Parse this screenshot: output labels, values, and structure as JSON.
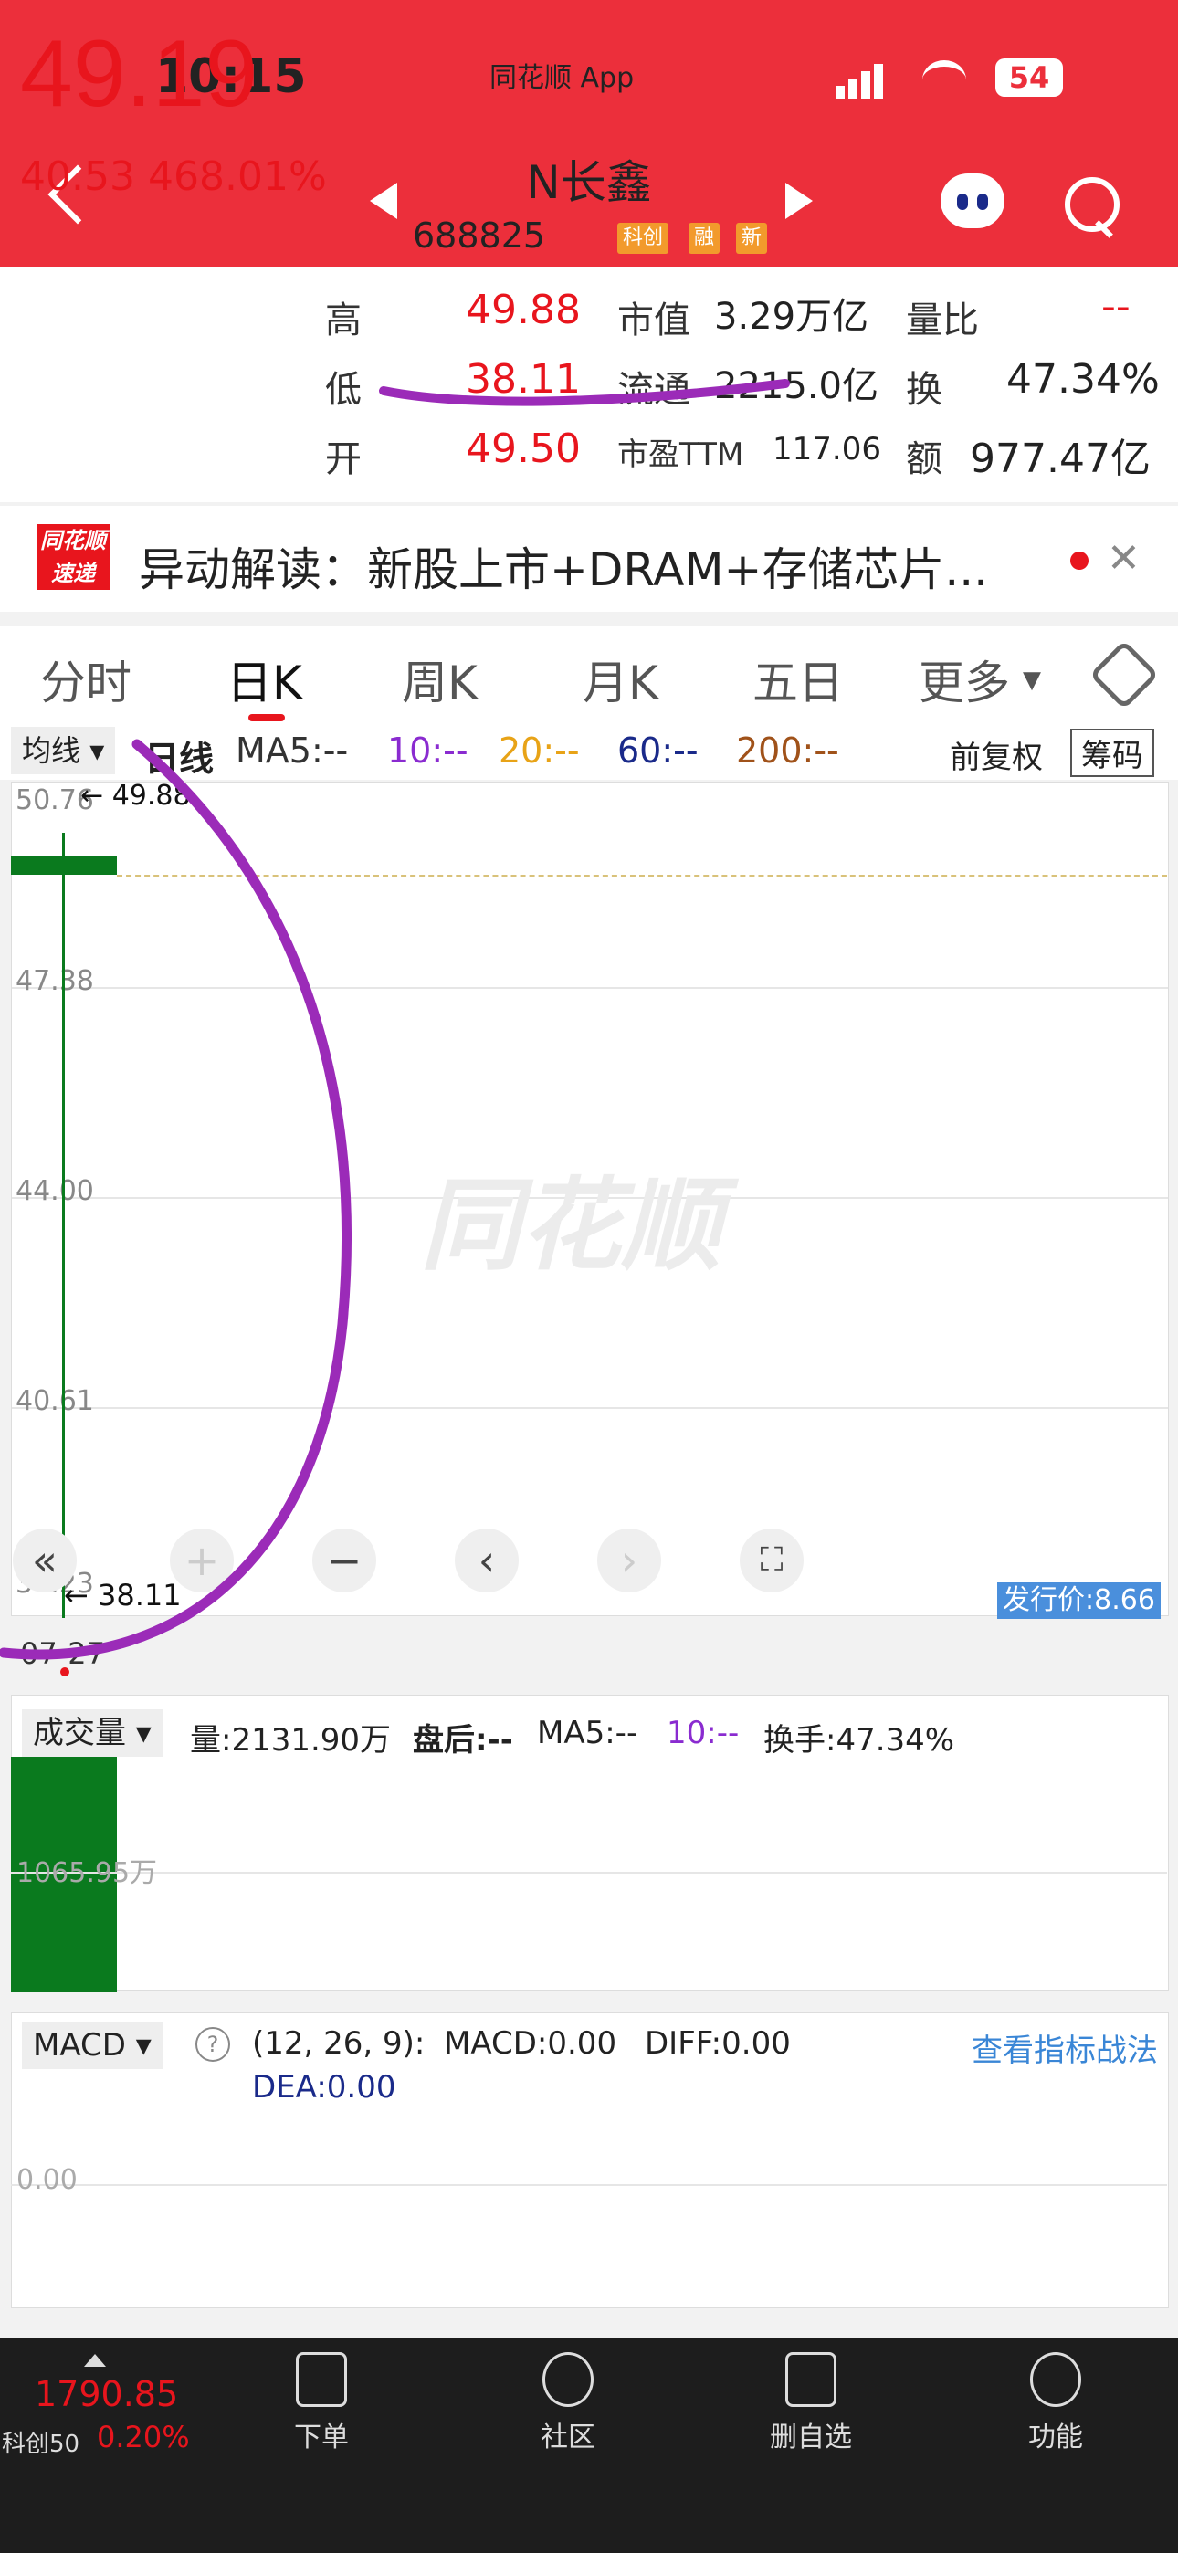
{
  "status_bar": {
    "time": "10:15",
    "app": "同花顺 App",
    "battery": "54"
  },
  "header": {
    "name": "N长鑫",
    "code": "688825",
    "tags": [
      "科创",
      "融",
      "新"
    ]
  },
  "quote": {
    "price": "49.19",
    "change": "40.53",
    "change_pct": "468.01%",
    "high_label": "高",
    "high": "49.88",
    "low_label": "低",
    "low": "38.11",
    "open_label": "开",
    "open": "49.50",
    "mcap_label": "市值",
    "mcap": "3.29万亿",
    "float_label": "流通",
    "float": "2215.0亿",
    "pe_label": "市盈TTM",
    "pe": "117.06",
    "vol_ratio_label": "量比",
    "vol_ratio": "--",
    "turnover_label": "换",
    "turnover": "47.34%",
    "amount_label": "额",
    "amount": "977.47亿"
  },
  "news": {
    "logo_top": "同花顺",
    "logo_bottom": "速递",
    "text": "异动解读：新股上市+DRAM+存储芯片..."
  },
  "tabs": [
    "分时",
    "日K",
    "周K",
    "月K",
    "五日",
    "更多"
  ],
  "indicator_bar": {
    "selector": "均线",
    "period": "日线",
    "ma5": "MA5:--",
    "ma10": "10:--",
    "ma20": "20:--",
    "ma60": "60:--",
    "ma200": "200:--",
    "adjust": "前复权",
    "chips": "筹码"
  },
  "kline": {
    "y_labels": [
      "50.76",
      "47.38",
      "44.00",
      "40.61",
      "37.23"
    ],
    "high_mark": "49.88",
    "low_mark": "38.11",
    "issue_price": "发行价:8.66",
    "date": "07-27",
    "watermark": "同花顺"
  },
  "volume": {
    "selector": "成交量",
    "vol": "量:2131.90万",
    "after": "盘后:--",
    "ma5": "MA5:--",
    "ma10": "10:--",
    "turnover": "换手:47.34%",
    "y_label": "1065.95万"
  },
  "macd": {
    "selector": "MACD",
    "params": "(12, 26, 9):",
    "macd": "MACD:0.00",
    "diff": "DIFF:0.00",
    "dea": "DEA:0.00",
    "link": "查看指标战法",
    "y_label": "0.00"
  },
  "bottom_nav": {
    "index_value": "1790.85",
    "index_name": "科创50",
    "index_pct": "0.20%",
    "items": [
      "下单",
      "社区",
      "删自选",
      "功能"
    ]
  },
  "colors": {
    "brand_red": "#ec2f3b",
    "up_red": "#e8151d",
    "candle_green": "#0a7a1e",
    "annotation_purple": "#9b2bb8",
    "issue_blue": "#4a8fdc"
  }
}
